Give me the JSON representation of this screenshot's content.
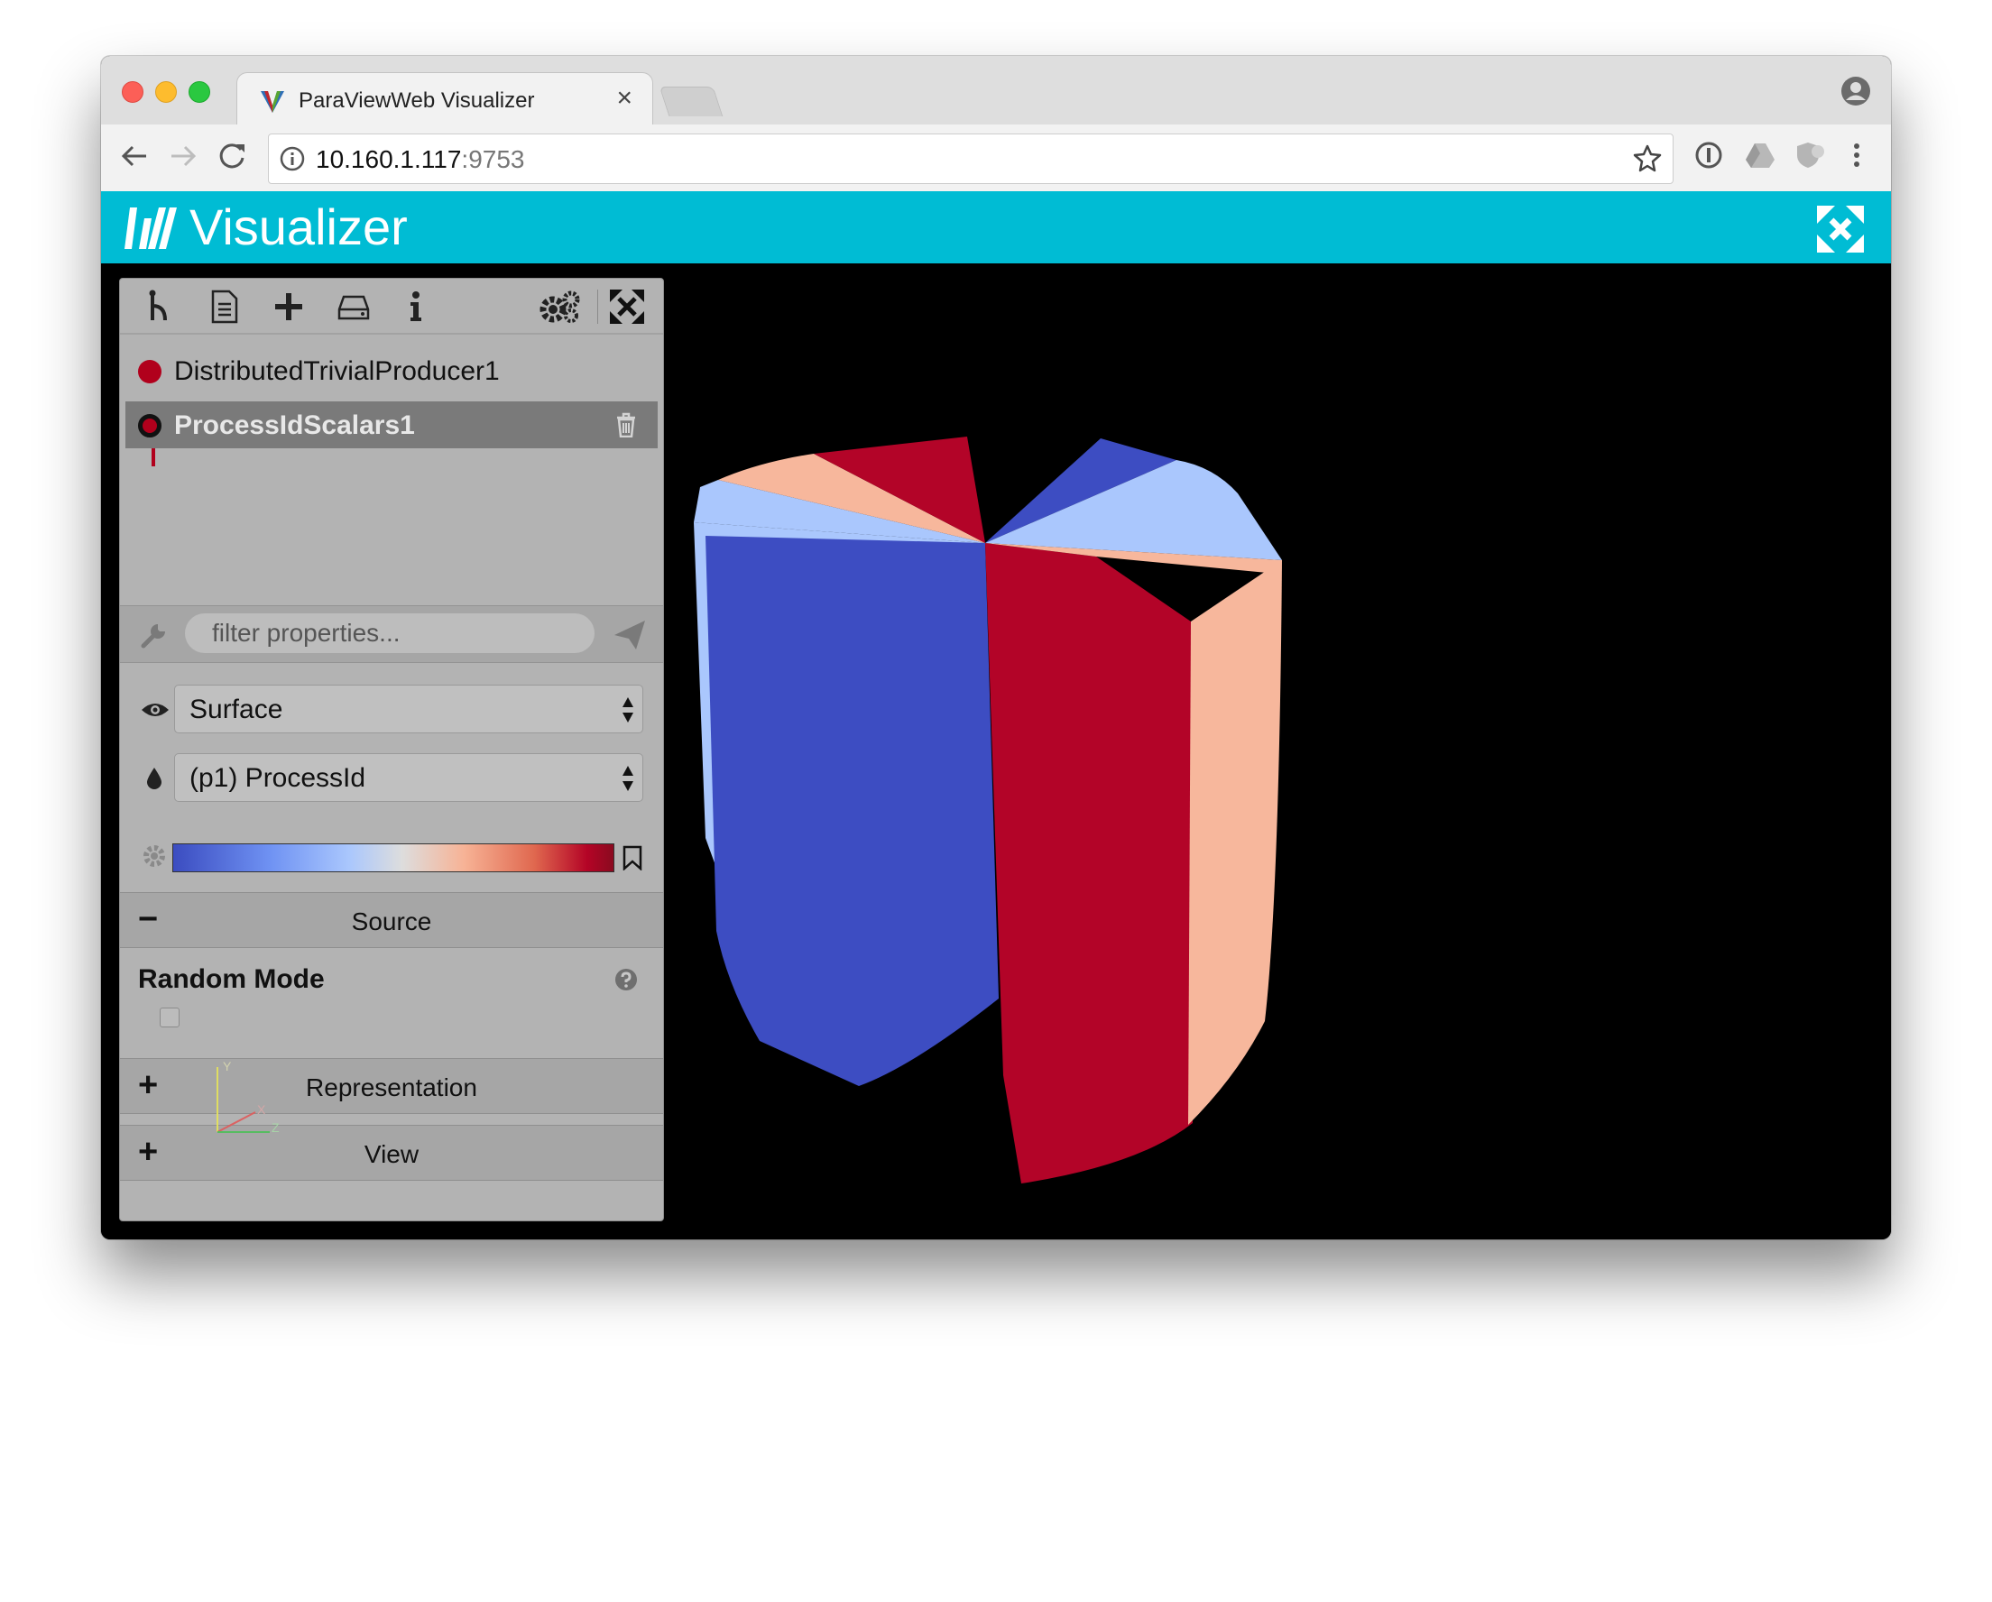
{
  "browser": {
    "tab_title": "ParaViewWeb Visualizer",
    "tab_close": "×",
    "url_host": "10.160.1.117",
    "url_port": ":9753"
  },
  "app": {
    "title": "Visualizer"
  },
  "pipeline": {
    "items": [
      {
        "name": "DistributedTrivialProducer1",
        "selected": false
      },
      {
        "name": "ProcessIdScalars1",
        "selected": true
      }
    ]
  },
  "filter": {
    "placeholder": "filter properties..."
  },
  "representation": {
    "value": "Surface"
  },
  "color_by": {
    "value": "(p1) ProcessId"
  },
  "colormap": {
    "name": "Cool to Warm",
    "colors": [
      "#3b4cc0",
      "#aac7fd",
      "#dddddd",
      "#f7b396",
      "#b40426"
    ]
  },
  "sections": {
    "source": {
      "sign": "−",
      "label": "Source"
    },
    "representation": {
      "sign": "+",
      "label": "Representation"
    },
    "view": {
      "sign": "+",
      "label": "View"
    }
  },
  "properties": {
    "random_mode": {
      "label": "Random Mode",
      "checked": false
    }
  },
  "axes": {
    "x": "X",
    "y": "Y",
    "z": "Z"
  },
  "colors": {
    "accent": "#00bcd4",
    "pipeline_dot": "#b1001c",
    "piece_dark_blue": "#3d4dc2",
    "piece_light_blue": "#a9c6fd",
    "piece_peach": "#f7b79c",
    "piece_red": "#b30428"
  }
}
